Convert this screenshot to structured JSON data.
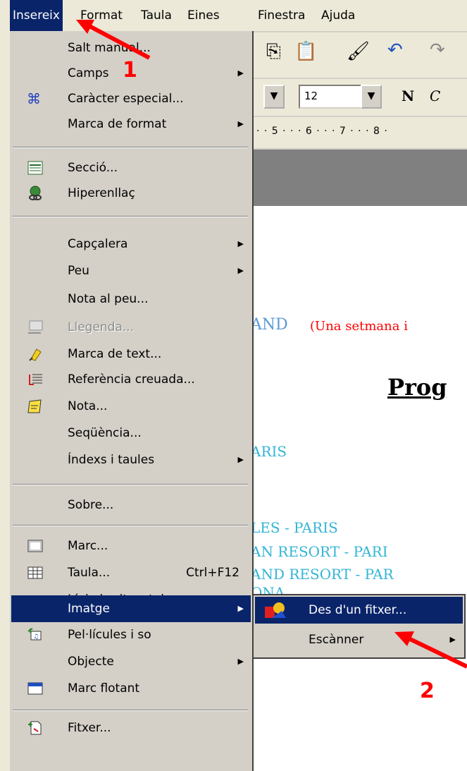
{
  "menubar": {
    "items": [
      {
        "id": "insert",
        "label": "Insereix"
      },
      {
        "id": "format",
        "label": "Format"
      },
      {
        "id": "table",
        "label": "Taula"
      },
      {
        "id": "tools",
        "label": "Eines"
      },
      {
        "id": "window",
        "label": "Finestra"
      },
      {
        "id": "help",
        "label": "Ajuda"
      }
    ]
  },
  "toolbar": {
    "font_size": "12",
    "bold_label": "N",
    "italic_label": "C",
    "ruler_text": "· · 5 · · · 6 · · · 7 · · · 8 ·"
  },
  "document": {
    "line1_blue": "AND",
    "line1_red": "(Una setmana i",
    "heading": "Prog",
    "line_paris": "ARIS",
    "line_les_paris": "LES - PARIS",
    "line_resort1": "AN RESORT - PARI",
    "line_resort2": "AND RESORT - PAR",
    "line_ona": "ONA"
  },
  "insert_menu": {
    "items": [
      {
        "label": "Salt manual...",
        "icon": "",
        "submenu": false
      },
      {
        "label": "Camps",
        "icon": "",
        "submenu": true
      },
      {
        "label": "Caràcter especial...",
        "icon": "special-character-icon",
        "submenu": false
      },
      {
        "label": "Marca de format",
        "icon": "",
        "submenu": true
      },
      {
        "label": "Secció...",
        "icon": "section-icon",
        "submenu": false
      },
      {
        "label": "Hiperenllaç",
        "icon": "hyperlink-icon",
        "submenu": false
      },
      {
        "label": "Capçalera",
        "icon": "",
        "submenu": true
      },
      {
        "label": "Peu",
        "icon": "",
        "submenu": true
      },
      {
        "label": "Nota al peu...",
        "icon": "",
        "submenu": false
      },
      {
        "label": "Llegenda...",
        "icon": "caption-icon",
        "submenu": false,
        "disabled": true
      },
      {
        "label": "Marca de text...",
        "icon": "bookmark-icon",
        "submenu": false
      },
      {
        "label": "Referència creuada...",
        "icon": "cross-reference-icon",
        "submenu": false
      },
      {
        "label": "Nota...",
        "icon": "note-icon",
        "submenu": false
      },
      {
        "label": "Seqüència...",
        "icon": "",
        "submenu": false
      },
      {
        "label": "Índexs i taules",
        "icon": "",
        "submenu": true
      },
      {
        "label": "Sobre...",
        "icon": "",
        "submenu": false
      },
      {
        "label": "Marc...",
        "icon": "frame-icon",
        "submenu": false
      },
      {
        "label": "Taula...",
        "icon": "table-icon",
        "submenu": false,
        "shortcut": "Ctrl+F12"
      },
      {
        "label": "Línia horitzontal...",
        "icon": "",
        "submenu": false
      },
      {
        "label": "Imatge",
        "icon": "",
        "submenu": true,
        "highlighted": true
      },
      {
        "label": "Pel·lícules i so",
        "icon": "movie-sound-icon",
        "submenu": false
      },
      {
        "label": "Objecte",
        "icon": "",
        "submenu": true
      },
      {
        "label": "Marc flotant",
        "icon": "floating-frame-icon",
        "submenu": false
      },
      {
        "label": "Fitxer...",
        "icon": "file-icon",
        "submenu": false
      }
    ]
  },
  "image_submenu": {
    "items": [
      {
        "label": "Des d'un fitxer...",
        "icon": "picture-from-file-icon",
        "highlighted": true
      },
      {
        "label": "Escànner",
        "submenu": true
      }
    ]
  },
  "annotations": {
    "step1": "1",
    "step2": "2",
    "arrow_color": "#ff0000"
  },
  "colors": {
    "menu_highlight": "#0a246a",
    "menu_bg": "#d4d0c8",
    "doc_blue_text": "#5b9bd5",
    "doc_cyan_text": "#33b5d5",
    "doc_red_text": "#ff0000"
  }
}
